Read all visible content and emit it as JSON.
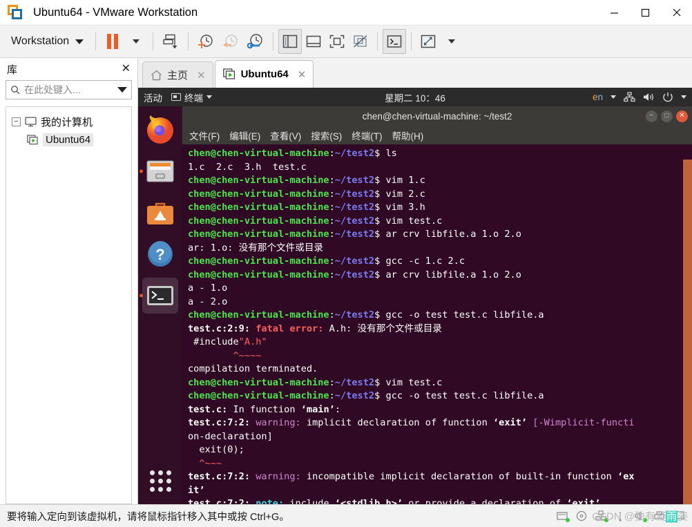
{
  "window": {
    "title": "Ubuntu64 - VMware Workstation",
    "logo_icon": "vmware-logo-icon",
    "controls": [
      {
        "name": "minimize-button",
        "icon": "minimize-icon",
        "label": "—"
      },
      {
        "name": "maximize-button",
        "icon": "maximize-icon",
        "label": "□"
      },
      {
        "name": "close-button",
        "icon": "close-icon",
        "label": "✕"
      }
    ]
  },
  "toolbar": {
    "workstation_label": "Workstation",
    "buttons": [
      {
        "name": "suspend-button",
        "icon": "pause-icon"
      },
      {
        "name": "power-dropdown-button",
        "icon": "chevron-down-icon"
      },
      {
        "name": "snapshot-manager-button",
        "icon": "snapshot-icon"
      },
      {
        "name": "take-snapshot-button",
        "icon": "clock-plus-icon"
      },
      {
        "name": "revert-snapshot-button",
        "icon": "clock-back-icon"
      },
      {
        "name": "manage-snapshots-button",
        "icon": "clock-wrench-icon"
      },
      {
        "name": "show-library-button",
        "icon": "panel-left-icon"
      },
      {
        "name": "show-thumbnail-bar-button",
        "icon": "panel-bottom-icon"
      },
      {
        "name": "full-screen-button",
        "icon": "fullscreen-icon"
      },
      {
        "name": "unity-mode-button",
        "icon": "unity-icon"
      },
      {
        "name": "console-view-button",
        "icon": "console-icon"
      },
      {
        "name": "stretch-view-button",
        "icon": "stretch-icon"
      },
      {
        "name": "stretch-dropdown-button",
        "icon": "chevron-down-icon"
      }
    ]
  },
  "library": {
    "title": "库",
    "close_icon": "close-icon",
    "search": {
      "icon": "search-icon",
      "placeholder": "在此处键入...",
      "value": "",
      "dropdown_icon": "chevron-down-icon"
    },
    "tree": [
      {
        "label": "我的计算机",
        "icon": "monitor-icon",
        "expander": "−"
      },
      {
        "label": "Ubuntu64",
        "icon": "vm-icon"
      }
    ]
  },
  "tabs": [
    {
      "label": "主页",
      "icon": "home-icon",
      "active": false,
      "close_icon": "close-icon"
    },
    {
      "label": "Ubuntu64",
      "icon": "vm-icon",
      "active": true,
      "close_icon": "close-icon"
    }
  ],
  "guest": {
    "topbar": {
      "activities": "活动",
      "app_menu": "终端",
      "app_menu_icon": "terminal-icon",
      "app_menu_caret": "chevron-down-icon",
      "clock": "星期二 10：46",
      "keyboard_layout": "en",
      "indicators": [
        {
          "name": "network-icon"
        },
        {
          "name": "volume-icon"
        },
        {
          "name": "power-icon"
        },
        {
          "name": "chevron-down-icon"
        }
      ]
    },
    "dock": [
      {
        "name": "dock-item-firefox",
        "icon": "firefox-icon",
        "running": false
      },
      {
        "name": "dock-item-files",
        "icon": "files-icon",
        "running": true
      },
      {
        "name": "dock-item-software",
        "icon": "ubuntu-software-icon",
        "running": false
      },
      {
        "name": "dock-item-help",
        "icon": "help-icon",
        "running": false
      },
      {
        "name": "dock-item-terminal",
        "icon": "terminal-icon",
        "running": true,
        "active": true
      }
    ],
    "show_apps_label": "show-applications",
    "terminal": {
      "title": "chen@chen-virtual-machine: ~/test2",
      "window_buttons": [
        {
          "name": "minimize-button",
          "glyph": "−"
        },
        {
          "name": "maximize-button",
          "glyph": "□"
        },
        {
          "name": "close-button",
          "glyph": "✕"
        }
      ],
      "menu": [
        "文件(F)",
        "编辑(E)",
        "查看(V)",
        "搜索(S)",
        "终端(T)",
        "帮助(H)"
      ],
      "prompt_user": "chen@chen-virtual-machine",
      "prompt_path": "~/test2",
      "lines": [
        {
          "type": "prompt",
          "cmd": " ls"
        },
        {
          "type": "out",
          "text": "1.c  2.c  3.h  test.c"
        },
        {
          "type": "prompt",
          "cmd": " vim 1.c"
        },
        {
          "type": "prompt",
          "cmd": " vim 2.c"
        },
        {
          "type": "prompt",
          "cmd": " vim 3.h"
        },
        {
          "type": "prompt",
          "cmd": " vim test.c"
        },
        {
          "type": "prompt",
          "cmd": " ar crv libfile.a 1.o 2.o"
        },
        {
          "type": "out",
          "text": "ar: 1.o: 没有那个文件或目录"
        },
        {
          "type": "prompt",
          "cmd": " gcc -c 1.c 2.c"
        },
        {
          "type": "prompt",
          "cmd": " ar crv libfile.a 1.o 2.o"
        },
        {
          "type": "out",
          "text": "a - 1.o"
        },
        {
          "type": "out",
          "text": "a - 2.o"
        },
        {
          "type": "prompt",
          "cmd": " gcc -o test test.c libfile.a"
        },
        {
          "type": "err_fatal",
          "loc": "test.c:2:9:",
          "sev": "fatal error:",
          "msg": " A.h: 没有那个文件或目录"
        },
        {
          "type": "include",
          "pre": " #include",
          "quoted": "\"A.h\""
        },
        {
          "type": "caret",
          "text": "        ^~~~~"
        },
        {
          "type": "out",
          "text": "compilation terminated."
        },
        {
          "type": "prompt",
          "cmd": " vim test.c"
        },
        {
          "type": "prompt",
          "cmd": " gcc -o test test.c libfile.a"
        },
        {
          "type": "infunc",
          "loc": "test.c:",
          "rest": " In function ",
          "fn": "‘main’",
          "tail": ":"
        },
        {
          "type": "warn",
          "loc": "test.c:7:2:",
          "sev": " warning:",
          "msg": " implicit declaration of function ",
          "fn": "‘exit’",
          "opt": " [-Wimplicit-functi"
        },
        {
          "type": "out",
          "text": "on-declaration]"
        },
        {
          "type": "out",
          "text": "  exit(0);"
        },
        {
          "type": "caret",
          "text": "  ^~~~"
        },
        {
          "type": "warn2",
          "loc": "test.c:7:2:",
          "sev": " warning:",
          "msg": " incompatible implicit declaration of built-in function ",
          "fn": "‘ex"
        },
        {
          "type": "out_b",
          "text": "it’"
        },
        {
          "type": "note",
          "loc": "test.c:7:2:",
          "sev": " note:",
          "msg1": " include ",
          "fn1": "‘<stdlib.h>’",
          "msg2": " or provide a declaration of ",
          "fn2": "‘exit’"
        },
        {
          "type": "prompt_cursor",
          "cmd": " "
        }
      ]
    }
  },
  "statusbar": {
    "message": "要将输入定向到该虚拟机，请将鼠标指针移入其中或按 Ctrl+G。",
    "icons": [
      {
        "name": "hard-disk-icon"
      },
      {
        "name": "cd-drive-icon"
      },
      {
        "name": "network-adapter-icon"
      },
      {
        "name": "usb-icon"
      },
      {
        "name": "sound-card-icon"
      },
      {
        "name": "printer-icon"
      },
      {
        "name": "display-icon"
      }
    ],
    "watermark_prefix": "CSDN @独有凝",
    "watermark_highlight": "雨",
    "watermark_suffix": "姿"
  }
}
